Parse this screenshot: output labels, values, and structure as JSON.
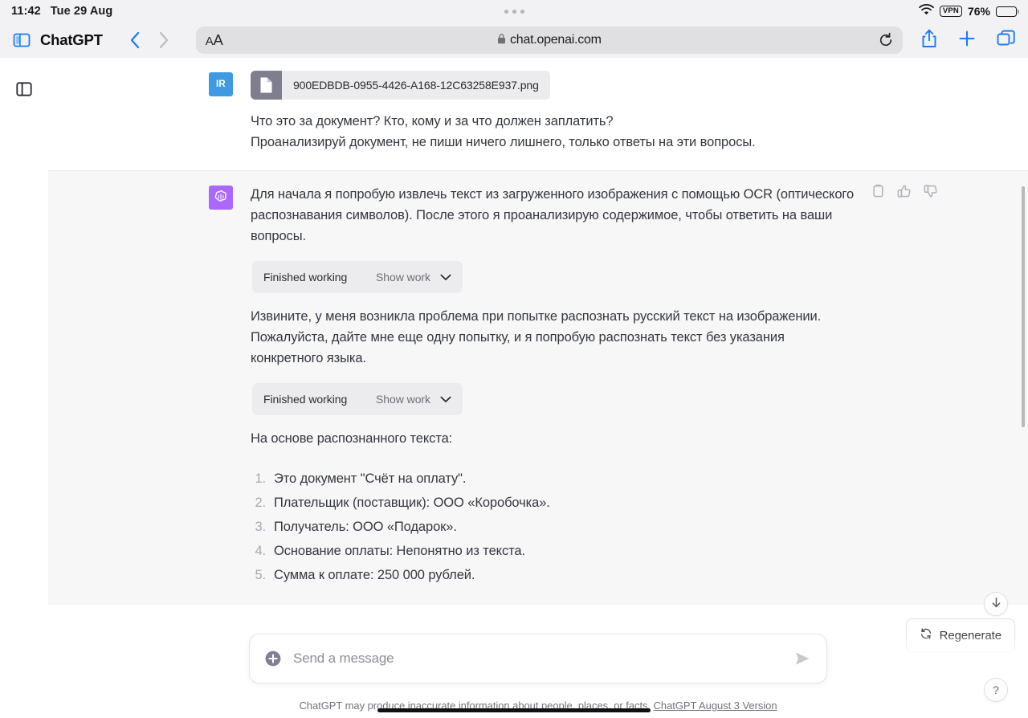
{
  "status_bar": {
    "time": "11:42",
    "date": "Tue 29 Aug",
    "wifi_icon": "wifi-icon",
    "vpn_badge": "VPN",
    "battery_percent": "76%",
    "battery_level": 76
  },
  "browser": {
    "tabs_icon": "tab-overview-icon",
    "app_title": "ChatGPT",
    "back_icon": "chevron-left-icon",
    "forward_icon": "chevron-right-icon",
    "text_size_label": "AA",
    "lock_icon": "lock-icon",
    "url": "chat.openai.com",
    "reload_icon": "reload-icon",
    "share_icon": "share-icon",
    "new_tab_icon": "plus-icon",
    "tab_switcher_icon": "tab-switcher-icon"
  },
  "sidebar": {
    "toggle_icon": "sidebar-toggle-icon"
  },
  "conversation": {
    "user_message": {
      "avatar_initials": "IR",
      "attachment": {
        "file_icon": "file-icon",
        "filename": "900EDBDB-0955-4426-A168-12C63258E937.png"
      },
      "lines": [
        "Что это за документ? Кто, кому и за что должен заплатить?",
        "Проанализируй документ, не пиши ничего лишнего, только ответы на эти вопросы."
      ]
    },
    "assistant_message": {
      "avatar_icon": "openai-logo-icon",
      "actions": [
        {
          "name": "copy-icon"
        },
        {
          "name": "thumbs-up-icon"
        },
        {
          "name": "thumbs-down-icon"
        }
      ],
      "paragraph_1": "Для начала я попробую извлечь текст из загруженного изображения с помощью OCR (оптического распознавания символов). После этого я проанализирую содержимое, чтобы ответить на ваши вопросы.",
      "tool_block_1": {
        "status": "Finished working",
        "toggle_label": "Show work",
        "chevron_icon": "chevron-down-icon"
      },
      "paragraph_2": "Извините, у меня возникла проблема при попытке распознать русский текст на изображении. Пожалуйста, дайте мне еще одну попытку, и я попробую распознать текст без указания конкретного языка.",
      "tool_block_2": {
        "status": "Finished working",
        "toggle_label": "Show work",
        "chevron_icon": "chevron-down-icon"
      },
      "paragraph_3": "На основе распознанного текста:",
      "answers": [
        {
          "num": "1.",
          "text": "Это документ \"Счёт на оплату\"."
        },
        {
          "num": "2.",
          "text": "Плательщик (поставщик): ООО «Коробочка»."
        },
        {
          "num": "3.",
          "text": "Получатель: ООО «Подарок»."
        },
        {
          "num": "4.",
          "text": "Основание оплаты: Непонятно из текста."
        },
        {
          "num": "5.",
          "text": "Сумма к оплате: 250 000 рублей."
        }
      ]
    }
  },
  "regenerate": {
    "icon": "refresh-icon",
    "label": "Regenerate"
  },
  "composer": {
    "add_icon": "plus-circle-icon",
    "placeholder": "Send a message",
    "send_icon": "send-icon"
  },
  "footer": {
    "disclaimer": "ChatGPT may produce inaccurate information about people, places, or facts.",
    "version_link": "ChatGPT August 3 Version"
  },
  "floating_buttons": {
    "scroll_to_bottom_icon": "arrow-down-icon",
    "help_label": "?"
  },
  "colors": {
    "accent_blue": "#1a7af8",
    "assistant_avatar": "#ab68ff",
    "user_avatar": "#3d9ae3",
    "assistant_bg": "#f7f7f8",
    "user_bg": "#ffffff"
  }
}
